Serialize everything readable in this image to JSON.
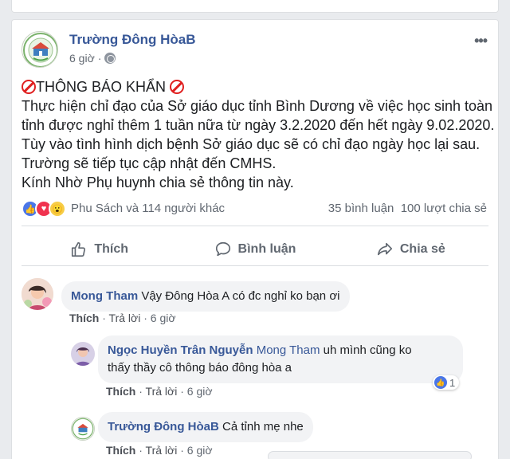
{
  "post": {
    "page_name": "Trường Đông HòaB",
    "time": "6 giờ",
    "more_icon": "more-dots-icon",
    "lines": [
      "THÔNG BÁO KHẨN",
      "Thực hiện chỉ đạo của Sở giáo dục tỉnh Bình Dương về việc học sinh toàn",
      "tỉnh được nghỉ thêm 1 tuần nữa từ ngày 3.2.2020 đến hết ngày 9.02.2020.",
      "Tùy vào tình hình dịch bệnh Sở giáo dục sẽ có chỉ đạo ngày học lại sau.",
      "Trường sẽ tiếp tục cập nhật đến CMHS.",
      "Kính Nhờ Phụ huynh chia sẻ thông tin này."
    ]
  },
  "reactions": {
    "names": "Phu Sách và 114 người khác",
    "comments": "35 bình luận",
    "shares": "100 lượt chia sẻ"
  },
  "actions": {
    "like": "Thích",
    "comment": "Bình luận",
    "share": "Chia sẻ"
  },
  "comments": [
    {
      "name": "Mong Tham",
      "text": "Vậy Đông Hòa A có đc nghỉ ko bạn ơi",
      "like": "Thích",
      "reply": "Trả lời",
      "time": "6 giờ"
    },
    {
      "name": "Ngọc Huyền Trân Nguyễn",
      "tag": "Mong Tham",
      "text_1": "uh mình cũng ko",
      "text_2": "thấy thầy cô thông báo đông hòa a",
      "like": "Thích",
      "reply": "Trả lời",
      "time": "6 giờ",
      "like_count": "1"
    },
    {
      "name": "Trường Đông HòaB",
      "text": "Cả tỉnh mẹ nhe",
      "like": "Thích",
      "reply": "Trả lời",
      "time": "6 giờ"
    }
  ],
  "colors": {
    "link": "#385898",
    "like_blue": "#4a76e8",
    "love_red": "#f0334f",
    "wow_yellow": "#f7cd46",
    "alert_red": "#e02020"
  }
}
